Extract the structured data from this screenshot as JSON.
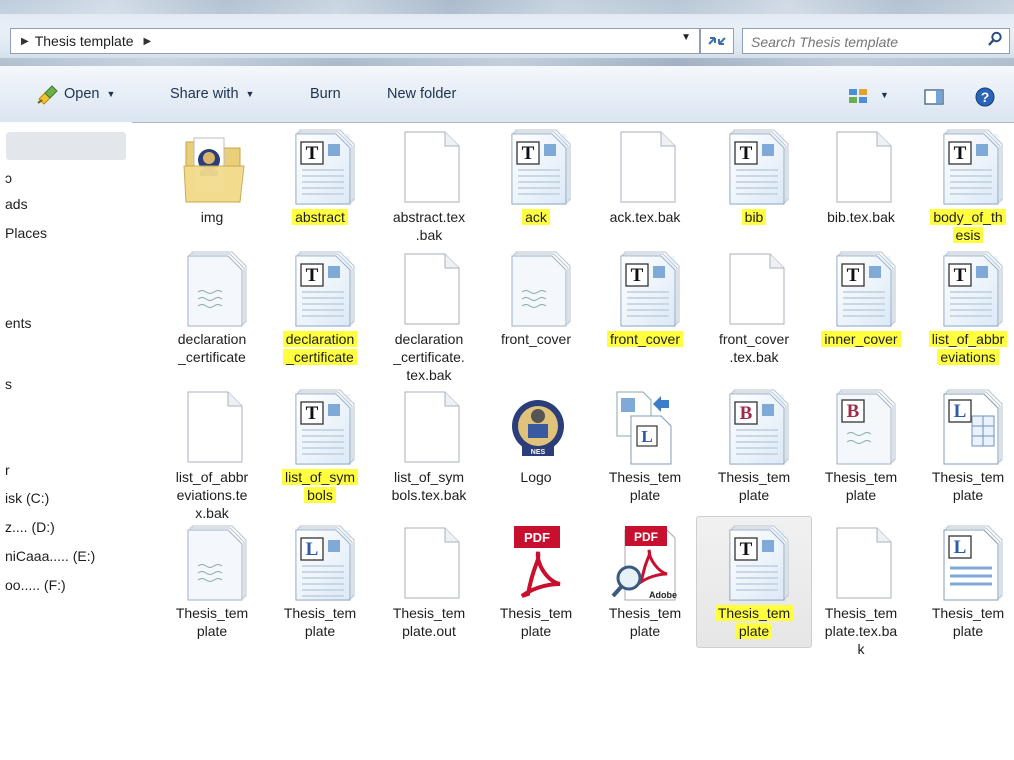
{
  "address": {
    "path_segment": "Thesis template",
    "search_placeholder": "Search Thesis template"
  },
  "toolbar": {
    "open_label": "Open",
    "share_label": "Share with",
    "burn_label": "Burn",
    "newfolder_label": "New folder"
  },
  "nav": {
    "items": [
      "ɔ",
      "ads",
      "Places",
      "ents",
      "s",
      "r",
      "isk (C:)",
      "z.... (D:)",
      "niCaaa..... (E:)",
      "oo..... (F:)"
    ]
  },
  "files": [
    {
      "label": "img",
      "icon": "folder-icon",
      "highlight": false
    },
    {
      "label": "abstract",
      "icon": "tex-icon",
      "highlight": true
    },
    {
      "label": "abstract.tex .bak",
      "icon": "blank-file-icon",
      "highlight": false
    },
    {
      "label": "ack",
      "icon": "tex-icon",
      "highlight": true
    },
    {
      "label": "ack.tex.bak",
      "icon": "blank-file-icon",
      "highlight": false
    },
    {
      "label": "bib",
      "icon": "tex-icon",
      "highlight": true
    },
    {
      "label": "bib.tex.bak",
      "icon": "blank-file-icon",
      "highlight": false
    },
    {
      "label": "body_of_th esis",
      "icon": "tex-icon",
      "highlight": true
    },
    {
      "label": "declaration _certificate",
      "icon": "text-file-icon",
      "highlight": false
    },
    {
      "label": "declaration _certificate",
      "icon": "tex-icon",
      "highlight": true
    },
    {
      "label": "declaration _certificate. tex.bak",
      "icon": "blank-file-icon",
      "highlight": false
    },
    {
      "label": "front_cover",
      "icon": "text-file-icon",
      "highlight": false
    },
    {
      "label": "front_cover",
      "icon": "tex-icon",
      "highlight": true
    },
    {
      "label": "front_cover .tex.bak",
      "icon": "blank-file-icon",
      "highlight": false
    },
    {
      "label": "inner_cover",
      "icon": "tex-icon",
      "highlight": true
    },
    {
      "label": "list_of_abbr eviations",
      "icon": "tex-icon",
      "highlight": true
    },
    {
      "label": "list_of_abbr eviations.te x.bak",
      "icon": "blank-file-icon",
      "highlight": false
    },
    {
      "label": "list_of_sym bols",
      "icon": "tex-icon",
      "highlight": true
    },
    {
      "label": "list_of_sym bols.tex.bak",
      "icon": "blank-file-icon",
      "highlight": false
    },
    {
      "label": "Logo",
      "icon": "logo-image-icon",
      "highlight": false
    },
    {
      "label": "Thesis_tem plate",
      "icon": "latex-multi-icon",
      "highlight": false
    },
    {
      "label": "Thesis_tem plate",
      "icon": "bib-file-icon",
      "highlight": false
    },
    {
      "label": "Thesis_tem plate",
      "icon": "bib-text-icon",
      "highlight": false
    },
    {
      "label": "Thesis_tem plate",
      "icon": "log-table-icon",
      "highlight": false
    },
    {
      "label": "Thesis_tem plate",
      "icon": "text-file-icon",
      "highlight": false
    },
    {
      "label": "Thesis_tem plate",
      "icon": "lof-file-icon",
      "highlight": false
    },
    {
      "label": "Thesis_tem plate.out",
      "icon": "blank-file-icon",
      "highlight": false
    },
    {
      "label": "Thesis_tem plate",
      "icon": "pdf-icon",
      "highlight": false
    },
    {
      "label": "Thesis_tem plate",
      "icon": "pdf-search-icon",
      "highlight": false
    },
    {
      "label": "Thesis_tem plate",
      "icon": "tex-icon",
      "highlight": true,
      "selected": true
    },
    {
      "label": "Thesis_tem plate.tex.ba k",
      "icon": "blank-file-icon",
      "highlight": false
    },
    {
      "label": "Thesis_tem plate",
      "icon": "lot-file-icon",
      "highlight": false
    }
  ]
}
